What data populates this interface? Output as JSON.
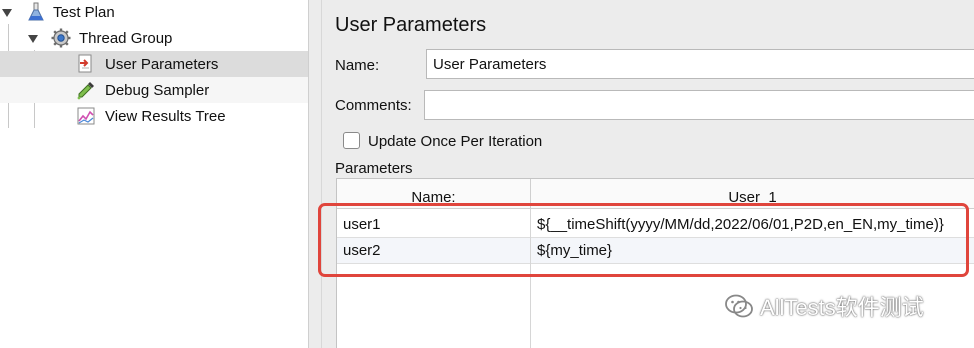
{
  "tree": {
    "items": [
      {
        "label": "Test Plan",
        "icon": "flask-icon"
      },
      {
        "label": "Thread Group",
        "icon": "gear-icon"
      },
      {
        "label": "User Parameters",
        "icon": "user-parameters-icon",
        "selected": true
      },
      {
        "label": "Debug Sampler",
        "icon": "dropper-icon"
      },
      {
        "label": "View Results Tree",
        "icon": "results-tree-icon"
      }
    ]
  },
  "panel": {
    "title": "User Parameters",
    "name_label": "Name:",
    "name_value": "User Parameters",
    "comments_label": "Comments:",
    "comments_value": "",
    "update_once_label": "Update Once Per Iteration",
    "update_once_checked": false,
    "parameters_label": "Parameters"
  },
  "table": {
    "headers": [
      "Name:",
      "User_1"
    ],
    "rows": [
      [
        "user1",
        "${__timeShift(yyyy/MM/dd,2022/06/01,P2D,en_EN,my_time)}"
      ],
      [
        "user2",
        "${my_time}"
      ]
    ]
  },
  "watermark": {
    "text": "AllTests软件测试"
  },
  "colors": {
    "highlight": "#e0453c",
    "selection": "#dcdcdc",
    "panel_bg": "#ececec"
  }
}
